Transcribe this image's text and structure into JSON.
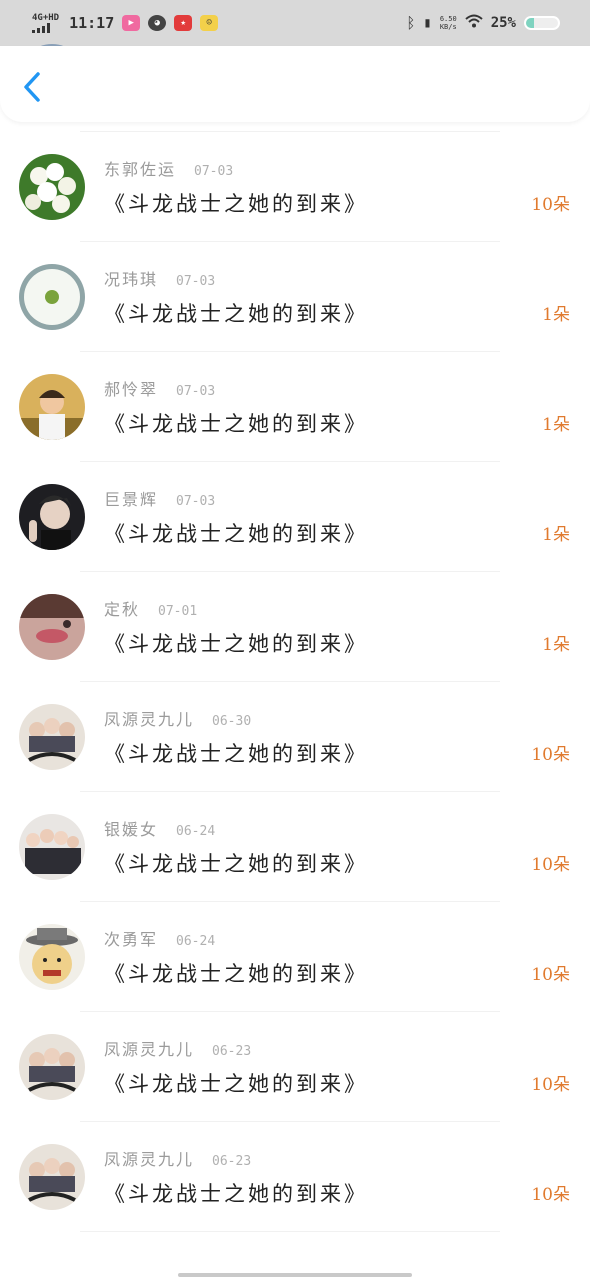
{
  "status_bar": {
    "network_type": "4G+HD",
    "time": "11:17",
    "speed_value": "6.50",
    "speed_unit": "KB/s",
    "battery": "25%",
    "battery_level": 0.25,
    "icons": [
      "signal-icon",
      "video-app-icon",
      "wechat-icon",
      "game-app-icon",
      "emoji-app-icon",
      "bluetooth-icon",
      "vibrate-icon",
      "wifi-icon",
      "battery-icon"
    ]
  },
  "header": {
    "back_icon": "chevron-left-icon"
  },
  "colors": {
    "accent": "#e07a2e",
    "back": "#2196f3",
    "name": "#9a9a9a",
    "title": "#222222"
  },
  "gifts": [
    {
      "name": "",
      "date": "",
      "title": "《斗龙战士之她的到来》",
      "count": "10朵",
      "avatar": "two-kids-photo"
    },
    {
      "name": "东郭佐运",
      "date": "07-03",
      "title": "《斗龙战士之她的到来》",
      "count": "10朵",
      "avatar": "white-flowers-photo"
    },
    {
      "name": "况玮琪",
      "date": "07-03",
      "title": "《斗龙战士之她的到来》",
      "count": "1朵",
      "avatar": "white-daisy-photo"
    },
    {
      "name": "郝怜翠",
      "date": "07-03",
      "title": "《斗龙战士之她的到来》",
      "count": "1朵",
      "avatar": "boy-in-field-photo"
    },
    {
      "name": "巨景辉",
      "date": "07-03",
      "title": "《斗龙战士之她的到来》",
      "count": "1朵",
      "avatar": "peace-sign-portrait"
    },
    {
      "name": "定秋",
      "date": "07-01",
      "title": "《斗龙战士之她的到来》",
      "count": "1朵",
      "avatar": "girl-lips-photo"
    },
    {
      "name": "凤源灵九儿",
      "date": "06-30",
      "title": "《斗龙战士之她的到来》",
      "count": "10朵",
      "avatar": "group-poster-photo"
    },
    {
      "name": "银媛女",
      "date": "06-24",
      "title": "《斗龙战士之她的到来》",
      "count": "10朵",
      "avatar": "girl-group-photo"
    },
    {
      "name": "次勇军",
      "date": "06-24",
      "title": "《斗龙战士之她的到来》",
      "count": "10朵",
      "avatar": "cartoon-man-hat"
    },
    {
      "name": "凤源灵九儿",
      "date": "06-23",
      "title": "《斗龙战士之她的到来》",
      "count": "10朵",
      "avatar": "group-poster-photo"
    },
    {
      "name": "凤源灵九儿",
      "date": "06-23",
      "title": "《斗龙战士之她的到来》",
      "count": "10朵",
      "avatar": "group-poster-photo"
    }
  ]
}
